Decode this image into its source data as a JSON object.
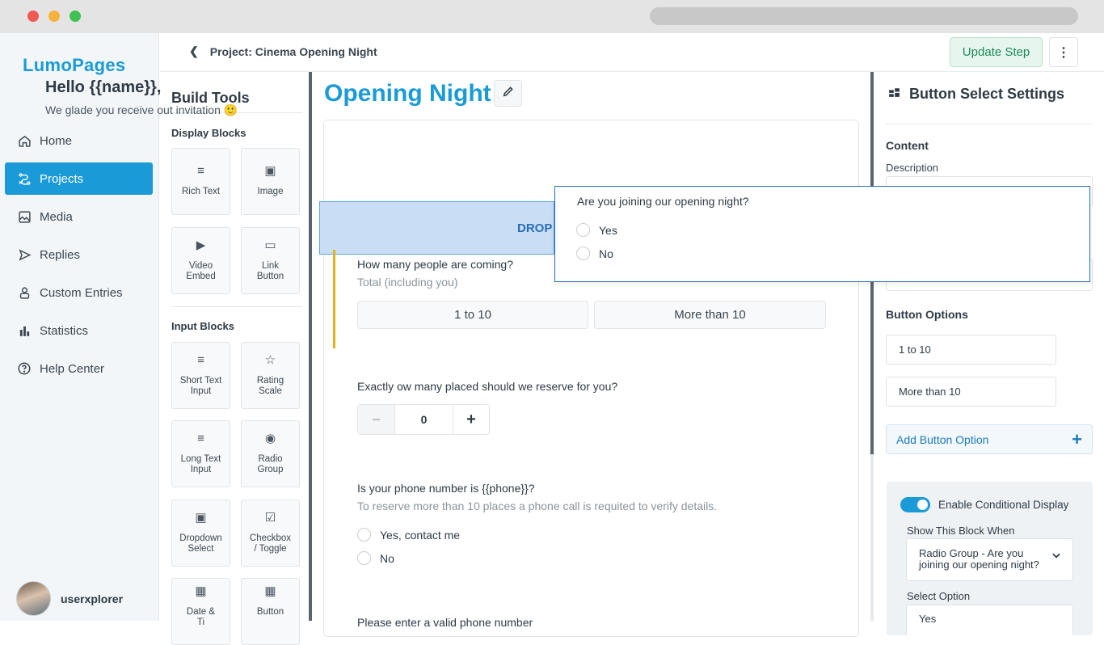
{
  "app": {
    "logo": "LumoPages"
  },
  "sidebar": {
    "items": [
      {
        "label": "Home",
        "icon": "home-icon"
      },
      {
        "label": "Projects",
        "icon": "projects-icon",
        "active": true
      },
      {
        "label": "Media",
        "icon": "media-icon"
      },
      {
        "label": "Replies",
        "icon": "replies-icon"
      },
      {
        "label": "Custom Entries",
        "icon": "custom-entries-icon"
      },
      {
        "label": "Statistics",
        "icon": "statistics-icon"
      },
      {
        "label": "Help Center",
        "icon": "help-icon"
      }
    ],
    "user": "userxplorer"
  },
  "header": {
    "breadcrumb": "Project: Cinema Opening Night",
    "update_label": "Update Step",
    "more_label": "⋮"
  },
  "tools": {
    "title": "Build Tools",
    "display_heading": "Display Blocks",
    "input_heading": "Input Blocks",
    "display": [
      {
        "label": "Rich Text",
        "glyph": "≡"
      },
      {
        "label": "Image",
        "glyph": "▣"
      },
      {
        "label": "Video\nEmbed",
        "glyph": "▶"
      },
      {
        "label": "Link\nButton",
        "glyph": "▭"
      }
    ],
    "input": [
      {
        "label": "Short Text\nInput",
        "glyph": "≡"
      },
      {
        "label": "Rating\nScale",
        "glyph": "☆"
      },
      {
        "label": "Long Text\nInput",
        "glyph": "≡"
      },
      {
        "label": "Radio\nGroup",
        "glyph": "◉"
      },
      {
        "label": "Dropdown\nSelect",
        "glyph": "▣"
      },
      {
        "label": "Checkbox\n/ Toggle",
        "glyph": "☑"
      },
      {
        "label": "Date &\nTi",
        "glyph": "▦"
      },
      {
        "label": "Button",
        "glyph": "▦"
      }
    ]
  },
  "canvas": {
    "title": "Opening Night",
    "greeting": "Hello {{name}},",
    "greeting_sub": "We glade you receive out invitation 🙂",
    "drop_label": "DROP",
    "q1": "How many people are coming?",
    "q1_hint": "Total (including you)",
    "q1_options": [
      "1 to 10",
      "More than 10"
    ],
    "q2": "Exactly ow many placed should we reserve for you?",
    "stepper_value": "0",
    "stepper_minus": "−",
    "stepper_plus": "+",
    "q3": "Is your phone number is {{phone}}?",
    "q3_hint": "To reserve more than 10 places a phone call is requited to verify details.",
    "q3_options": [
      "Yes, contact me",
      "No"
    ],
    "q4_partial": "Please enter a valid phone number"
  },
  "popup": {
    "question": "Are you joining our opening night?",
    "options": [
      "Yes",
      "No"
    ]
  },
  "panel": {
    "title": "Button Select Settings",
    "content_heading": "Content",
    "description_label": "Description",
    "options_heading": "Button Options",
    "options": [
      "1 to 10",
      "More than 10"
    ],
    "add_option": "Add Button Option",
    "add_icon": "+",
    "conditional": {
      "label": "Enable Conditional Display",
      "enabled": true,
      "show_when_label": "Show This Block When",
      "show_when_value": "Radio Group - Are you joining our opening night?",
      "select_option_label": "Select Option",
      "select_option_value": "Yes"
    }
  },
  "colors": {
    "accent": "#1a9bd7",
    "update_bg": "#e6f6ee",
    "drop_bg": "#c9def5",
    "marker": "#e3b21a"
  }
}
